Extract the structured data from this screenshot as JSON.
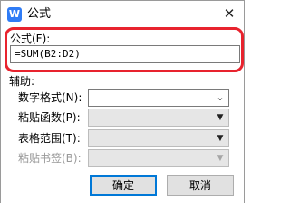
{
  "window": {
    "icon_glyph": "W",
    "title": "公式",
    "close_glyph": "✕"
  },
  "formula": {
    "label": "公式(F):",
    "value": "=SUM(B2:D2)"
  },
  "aux": {
    "section_label": "辅助:",
    "number_format_label": "数字格式(N):",
    "paste_function_label": "粘贴函数(P):",
    "table_range_label": "表格范围(T):",
    "paste_bookmark_label": "粘贴书签(B):"
  },
  "buttons": {
    "ok": "确定",
    "cancel": "取消"
  },
  "colors": {
    "annotation_highlight": "#e8232e",
    "app_icon": "#2f7cf6",
    "default_button_border": "#0078d7"
  }
}
